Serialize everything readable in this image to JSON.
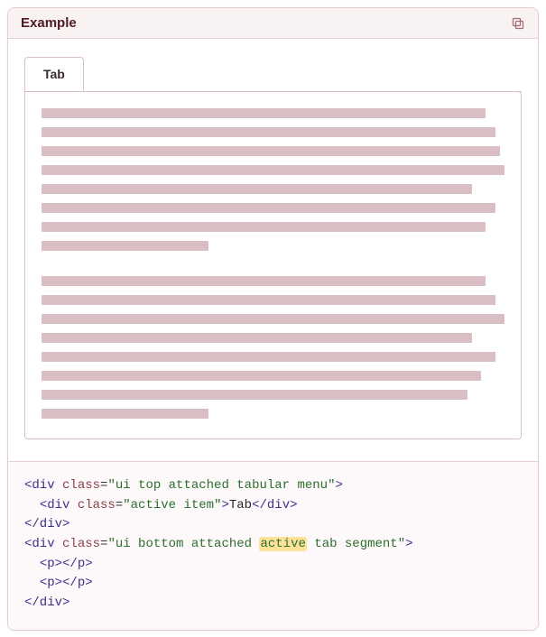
{
  "card": {
    "title": "Example"
  },
  "tabs": {
    "items": [
      {
        "label": "Tab"
      }
    ]
  },
  "placeholder": {
    "paragraphs": [
      {
        "line_widths_pct": [
          96,
          98,
          99,
          100,
          93,
          98,
          96,
          36
        ]
      },
      {
        "line_widths_pct": [
          96,
          98,
          100,
          93,
          98,
          95,
          92,
          36
        ]
      }
    ]
  },
  "code": {
    "lines": [
      {
        "indent": 0,
        "type": "open",
        "tag": "div",
        "attrs": [
          {
            "name": "class",
            "value": "ui top attached tabular menu"
          }
        ]
      },
      {
        "indent": 1,
        "type": "full",
        "tag": "div",
        "attrs": [
          {
            "name": "class",
            "value": "active item"
          }
        ],
        "text": "Tab"
      },
      {
        "indent": 0,
        "type": "close",
        "tag": "div"
      },
      {
        "indent": 0,
        "type": "open",
        "tag": "div",
        "attrs": [
          {
            "name": "class",
            "value": "ui bottom attached active tab segment",
            "highlight": "active"
          }
        ]
      },
      {
        "indent": 1,
        "type": "full",
        "tag": "p",
        "attrs": []
      },
      {
        "indent": 1,
        "type": "full",
        "tag": "p",
        "attrs": []
      },
      {
        "indent": 0,
        "type": "close",
        "tag": "div"
      }
    ]
  }
}
